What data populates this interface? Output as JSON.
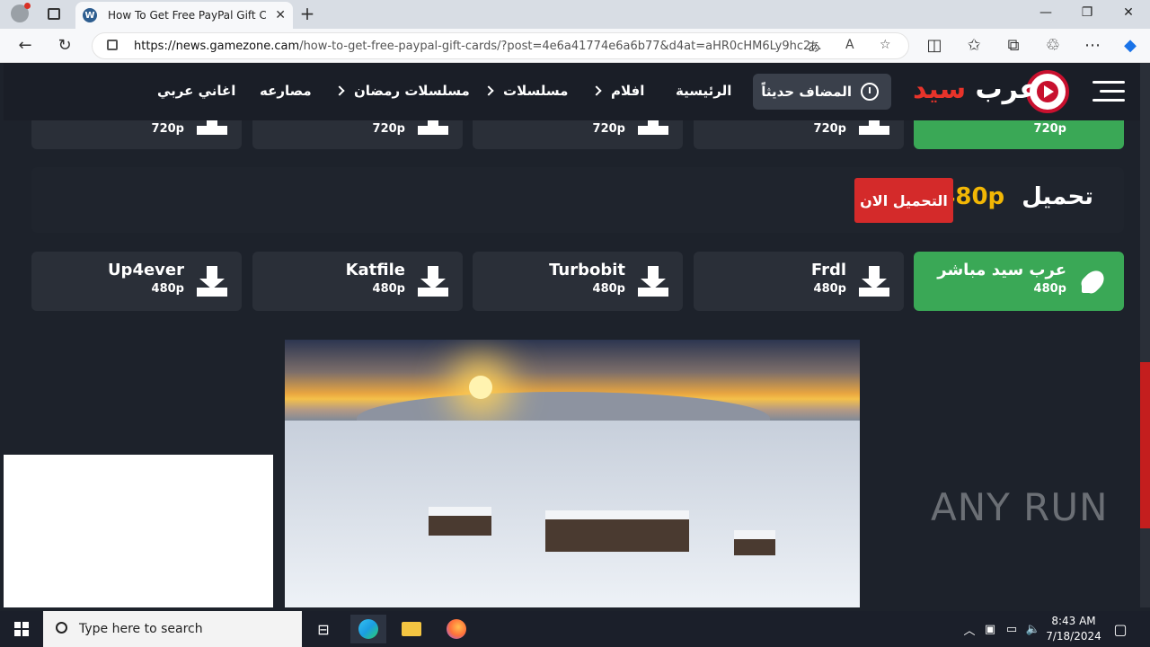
{
  "browser": {
    "tab_title": "How To Get Free PayPal Gift Card",
    "url_host": "https://news.gamezone.cam",
    "url_path": "/how-to-get-free-paypal-gift-cards/?post=4e6a41774e6a6b77&d4at=aHR0cHM6Ly9hc2...",
    "new_tab": "+",
    "minimize": "—",
    "maximize": "❐",
    "close": "✕"
  },
  "site": {
    "logo_word1": "عرب",
    "logo_word2": "سيد",
    "recent_label": "المضاف حديثاً",
    "nav": [
      "الرئيسية",
      "افلام",
      "مسلسلات",
      "مسلسلات رمضان",
      "مصارعه",
      "اغاني عربي"
    ]
  },
  "top_row": {
    "quality": "720p"
  },
  "section": {
    "title": "تحميل",
    "quality": "480p",
    "download_now": "التحميل الان"
  },
  "downloads": [
    {
      "name": "عرب سيد مباشر",
      "quality": "480p",
      "highlight": true
    },
    {
      "name": "Frdl",
      "quality": "480p"
    },
    {
      "name": "Turbobit",
      "quality": "480p"
    },
    {
      "name": "Katfile",
      "quality": "480p"
    },
    {
      "name": "Up4ever",
      "quality": "480p"
    }
  ],
  "watermark": "ANY RUN",
  "taskbar": {
    "search_placeholder": "Type here to search",
    "time": "8:43 AM",
    "date": "7/18/2024"
  },
  "colors": {
    "accent_green": "#3aa856",
    "accent_red": "#d42a2a",
    "accent_yellow": "#f2b705",
    "page_bg": "#1d222b"
  }
}
